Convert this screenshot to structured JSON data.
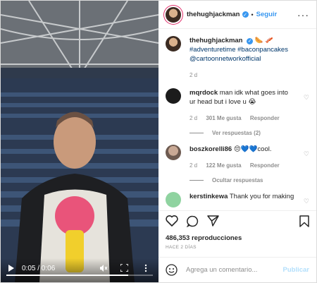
{
  "video": {
    "time": "0:05 / 0:06",
    "progress": 0.83,
    "icons": [
      "play-icon",
      "mute-icon",
      "fullscreen-icon",
      "more-vertical-icon"
    ]
  },
  "header": {
    "username": "thehughjackman",
    "follow": "Seguir",
    "separator": "•"
  },
  "caption": {
    "username": "thehughjackman",
    "emoji": "🌭 🥓",
    "hashtags": "#adventuretime #baconpancakes",
    "mention": "@cartoonnetworkofficial",
    "age": "2 d"
  },
  "comments": [
    {
      "username": "mqrdock",
      "text": "man idk what goes into ur head but i love u 😭",
      "age": "2 d",
      "likes": "301 Me gusta",
      "reply": "Responder",
      "replies_label": "Ver respuestas (2)"
    },
    {
      "username": "boszkorelli86",
      "text": "😔💙💙cool.",
      "age": "2 d",
      "likes": "122 Me gusta",
      "reply": "Responder",
      "replies_label": "Ocultar respuestas"
    },
    {
      "username": "kerstinkewa",
      "text": "Thank you for making"
    }
  ],
  "actions": {
    "views": "486,353 reproducciones",
    "posted": "HACE 2 DÍAS"
  },
  "add_comment": {
    "placeholder": "Agrega un comentario...",
    "publish": "Publicar"
  },
  "colors": {
    "accent": "#3897f0",
    "text": "#262626",
    "muted": "#8e8e8e",
    "publish_disabled": "#b2dffc"
  }
}
